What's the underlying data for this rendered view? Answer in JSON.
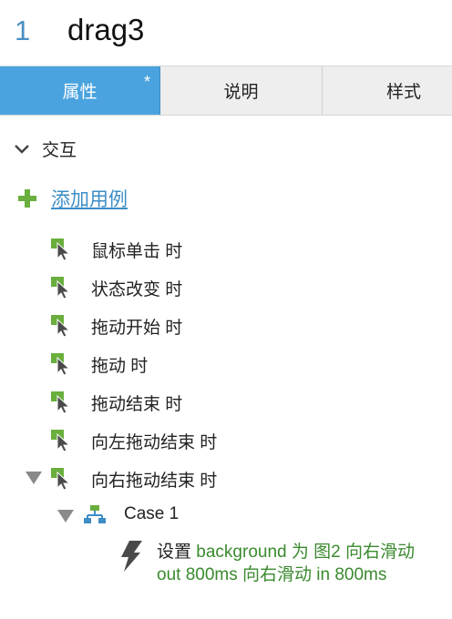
{
  "header": {
    "index": "1",
    "name": "drag3"
  },
  "tabs": [
    {
      "label": "属性",
      "marker": "*"
    },
    {
      "label": "说明"
    },
    {
      "label": "样式"
    }
  ],
  "section": {
    "label": "交互"
  },
  "add_case": {
    "label": "添加用例"
  },
  "events": [
    {
      "label": "鼠标单击 时"
    },
    {
      "label": "状态改变 时"
    },
    {
      "label": "拖动开始 时"
    },
    {
      "label": "拖动 时"
    },
    {
      "label": "拖动结束 时"
    },
    {
      "label": "向左拖动结束 时"
    },
    {
      "label": "向右拖动结束 时"
    }
  ],
  "case": {
    "label": "Case 1"
  },
  "action": {
    "verb": "设置",
    "detail": "background 为 图2 向右滑动 out 800ms 向右滑动 in 800ms"
  },
  "colors": {
    "accent": "#4aa3df",
    "green": "#6aaf3d",
    "action_text": "#3a8a2e",
    "link": "#3d8dc6"
  }
}
